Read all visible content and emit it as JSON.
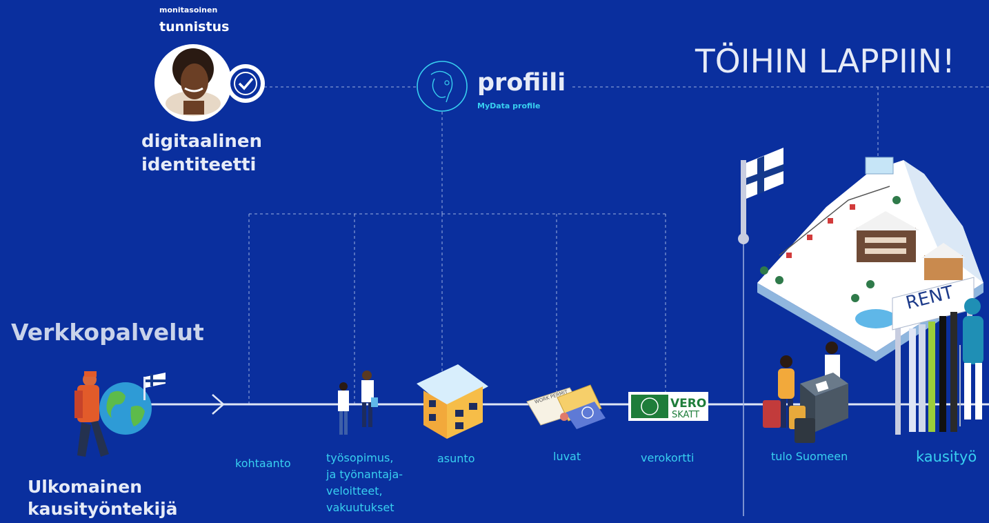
{
  "identity": {
    "small_label": "monitasoinen",
    "bold_label": "tunnistus",
    "title_line1": "digitaalinen",
    "title_line2": "identiteetti"
  },
  "profile": {
    "title": "profiili",
    "subtitle": "MyData profile"
  },
  "headline": "TÖIHIN LAPPIIN!",
  "online_services": "Verkkopalvelut",
  "worker": {
    "line1": "Ulkomainen",
    "line2": "kausityöntekijä"
  },
  "steps": [
    {
      "label": "kohtaanto"
    },
    {
      "label_lines": [
        "työsopimus,",
        "ja työnantaja-",
        "veloitteet,",
        "vakuutukset"
      ]
    },
    {
      "label": "asunto"
    },
    {
      "label": "luvat"
    },
    {
      "label": "verokortti"
    },
    {
      "label": "tulo Suomeen"
    },
    {
      "label": "kausityö"
    }
  ],
  "vero_logo": {
    "line1": "VERO",
    "line2": "SKATT"
  },
  "rent_sign": "RENT",
  "permit_text": "WORK PERMIT",
  "colors": {
    "background": "#0a2f9e",
    "accent": "#38d0f0",
    "text_light": "#e6ebf7",
    "line": "#dfe6f6",
    "vero_green": "#1e7d3a"
  }
}
